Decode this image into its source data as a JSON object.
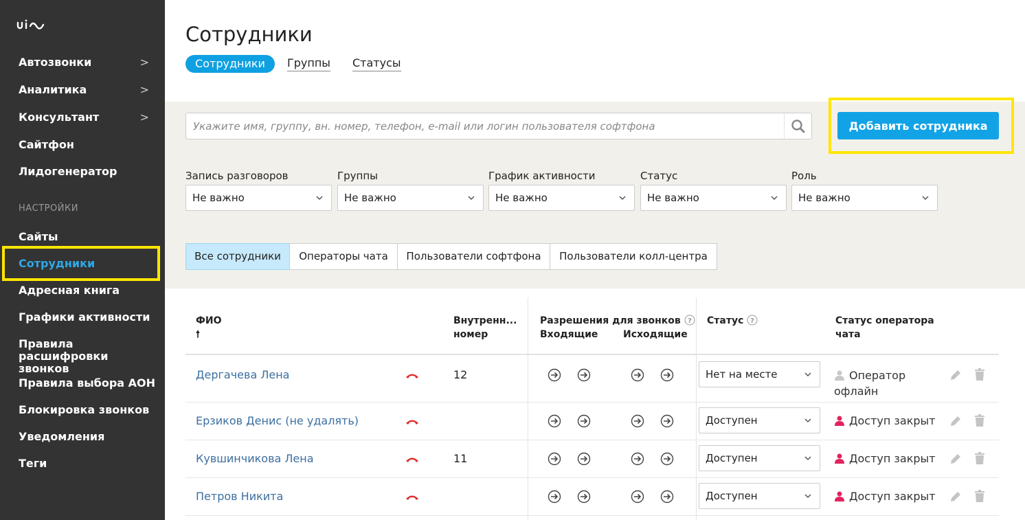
{
  "sidebar": {
    "logo_icon": "uis-logo-icon",
    "items": [
      {
        "label": "Автозвонки",
        "chevron": ">"
      },
      {
        "label": "Аналитика",
        "chevron": ">"
      },
      {
        "label": "Консультант",
        "chevron": ">"
      },
      {
        "label": "Сайтфон",
        "chevron": ""
      },
      {
        "label": "Лидогенератор",
        "chevron": ""
      }
    ],
    "section_label": "НАСТРОЙКИ",
    "settings_items": [
      {
        "label": "Сайты"
      },
      {
        "label": "Сотрудники"
      },
      {
        "label": "Адресная книга"
      },
      {
        "label": "Графики активности"
      },
      {
        "label": "Правила расшифровки звонков"
      },
      {
        "label": "Правила выбора АОН"
      },
      {
        "label": "Блокировка звонков"
      },
      {
        "label": "Уведомления"
      },
      {
        "label": "Теги"
      }
    ],
    "active_color": "#2fa8e6",
    "highlight_color": "#ffe600"
  },
  "header": {
    "title": "Сотрудники",
    "tabs": [
      {
        "label": "Сотрудники"
      },
      {
        "label": "Группы"
      },
      {
        "label": "Статусы"
      }
    ]
  },
  "search": {
    "placeholder": "Укажите имя, группу, вн. номер, телефон, e-mail или логин пользователя софтфона",
    "icon": "search-icon"
  },
  "add_button": {
    "label": "Добавить сотрудника",
    "color": "#12a3e6"
  },
  "filters": [
    {
      "label": "Запись разговоров",
      "value": "Не важно"
    },
    {
      "label": "Группы",
      "value": "Не важно"
    },
    {
      "label": "График активности",
      "value": "Не важно"
    },
    {
      "label": "Статус",
      "value": "Не важно"
    },
    {
      "label": "Роль",
      "value": "Не важно"
    }
  ],
  "segments": [
    {
      "label": "Все сотрудники"
    },
    {
      "label": "Операторы чата"
    },
    {
      "label": "Пользователи софтфона"
    },
    {
      "label": "Пользователи колл-центра"
    }
  ],
  "table": {
    "headers": {
      "name": "ФИО",
      "sort_arrow": "🠕",
      "ext_line1": "Внутренн...",
      "ext_line2": "номер",
      "perms": "Разрешения для звонков",
      "incoming": "Входящие",
      "outgoing": "Исходящие",
      "status": "Статус",
      "chat_status_line1": "Статус оператора",
      "chat_status_line2": "чата"
    },
    "rows": [
      {
        "name": "Дергачева Лена",
        "ext": "12",
        "status": "Нет на месте",
        "chat_status_line1": "Оператор",
        "chat_status_line2": "офлайн",
        "chat_icon_color": "#c8c8c8"
      },
      {
        "name": "Ерзиков Денис (не удалять)",
        "ext": "",
        "status": "Доступен",
        "chat_status_line1": "Доступ закрыт",
        "chat_status_line2": "",
        "chat_icon_color": "#e0245e"
      },
      {
        "name": "Кувшинчикова Лена",
        "ext": "11",
        "status": "Доступен",
        "chat_status_line1": "Доступ закрыт",
        "chat_status_line2": "",
        "chat_icon_color": "#e0245e"
      },
      {
        "name": "Петров Никита",
        "ext": "",
        "status": "Доступен",
        "chat_status_line1": "Доступ закрыт",
        "chat_status_line2": "",
        "chat_icon_color": "#e0245e"
      }
    ],
    "hangup_color": "#e03030"
  }
}
